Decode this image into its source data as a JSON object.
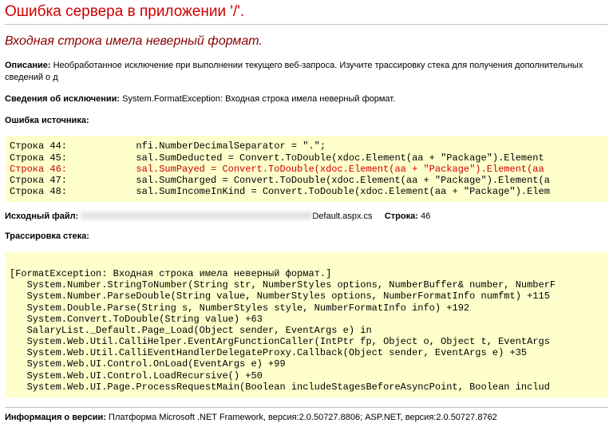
{
  "title": "Ошибка сервера в приложении '/'.",
  "subhead": "Входная строка имела неверный формат.",
  "description": {
    "label": "Описание:",
    "text": "Необработанное исключение при выполнении текущего веб-запроса. Изучите трассировку стека для получения дополнительных сведений о д"
  },
  "exceptionDetails": {
    "label": "Сведения об исключении:",
    "text": "System.FormatException: Входная строка имела неверный формат."
  },
  "sourceError": {
    "label": "Ошибка источника:",
    "lines": [
      {
        "n": "Строка 44:",
        "code": "            nfi.NumberDecimalSeparator = \".\";"
      },
      {
        "n": "Строка 45:",
        "code": "            sal.SumDeducted = Convert.ToDouble(xdoc.Element(aa + \"Package\").Element "
      },
      {
        "n": "Строка 46:",
        "code": "            sal.SumPayed = Convert.ToDouble(xdoc.Element(aa + \"Package\").Element(aa",
        "hl": true
      },
      {
        "n": "Строка 47:",
        "code": "            sal.SumCharged = Convert.ToDouble(xdoc.Element(aa + \"Package\").Element(a"
      },
      {
        "n": "Строка 48:",
        "code": "            sal.SumIncomeInKind = Convert.ToDouble(xdoc.Element(aa + \"Package\").Elem"
      }
    ]
  },
  "sourceFile": {
    "label": "Исходный файл:",
    "suffix": "Default.aspx.cs",
    "lineLabel": "Строка:",
    "lineNum": "46"
  },
  "stackTrace": {
    "label": "Трассировка стека:",
    "lines": [
      "",
      "[FormatException: Входная строка имела неверный формат.]",
      "   System.Number.StringToNumber(String str, NumberStyles options, NumberBuffer& number, NumberF",
      "   System.Number.ParseDouble(String value, NumberStyles options, NumberFormatInfo numfmt) +115",
      "   System.Double.Parse(String s, NumberStyles style, NumberFormatInfo info) +192",
      "   System.Convert.ToDouble(String value) +63",
      "   SalaryList._Default.Page_Load(Object sender, EventArgs e) in ",
      "   System.Web.Util.CalliHelper.EventArgFunctionCaller(IntPtr fp, Object o, Object t, EventArgs ",
      "   System.Web.Util.CalliEventHandlerDelegateProxy.Callback(Object sender, EventArgs e) +35",
      "   System.Web.UI.Control.OnLoad(EventArgs e) +99",
      "   System.Web.UI.Control.LoadRecursive() +50",
      "   System.Web.UI.Page.ProcessRequestMain(Boolean includeStagesBeforeAsyncPoint, Boolean includ"
    ]
  },
  "version": {
    "label": "Информация о версии:",
    "text": "Платформа Microsoft .NET Framework, версия:2.0.50727.8806; ASP.NET, версия:2.0.50727.8762"
  }
}
